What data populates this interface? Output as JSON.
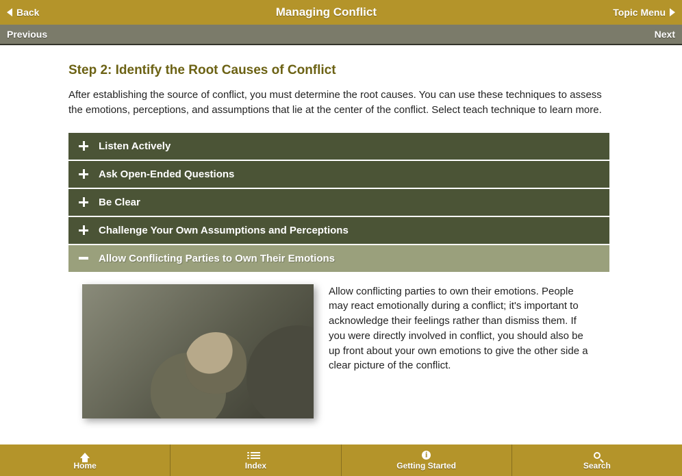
{
  "topbar": {
    "back": "Back",
    "title": "Managing Conflict",
    "topicMenu": "Topic Menu"
  },
  "navbar": {
    "previous": "Previous",
    "next": "Next"
  },
  "page": {
    "stepTitle": "Step 2: Identify the Root Causes of Conflict",
    "intro": "After establishing the source of conflict, you must determine the root causes. You can use these techniques to assess the emotions, perceptions, and assumptions that lie at the center of the conflict. Select teach technique to learn more."
  },
  "accordion": [
    {
      "label": "Listen Actively",
      "expanded": false
    },
    {
      "label": "Ask Open-Ended Questions",
      "expanded": false
    },
    {
      "label": "Be Clear",
      "expanded": false
    },
    {
      "label": "Challenge Your Own Assumptions and Perceptions",
      "expanded": false
    },
    {
      "label": "Allow Conflicting Parties to Own Their Emotions",
      "expanded": true,
      "body": "Allow conflicting parties to own their emotions. People may react emotionally during a conflict; it's important to acknowledge their feelings rather than dismiss them. If you were directly involved in conflict, you should also be up front about your own emotions to give the other side a clear picture of the conflict."
    }
  ],
  "bottombar": {
    "home": "Home",
    "index": "Index",
    "gettingStarted": "Getting Started",
    "search": "Search"
  }
}
